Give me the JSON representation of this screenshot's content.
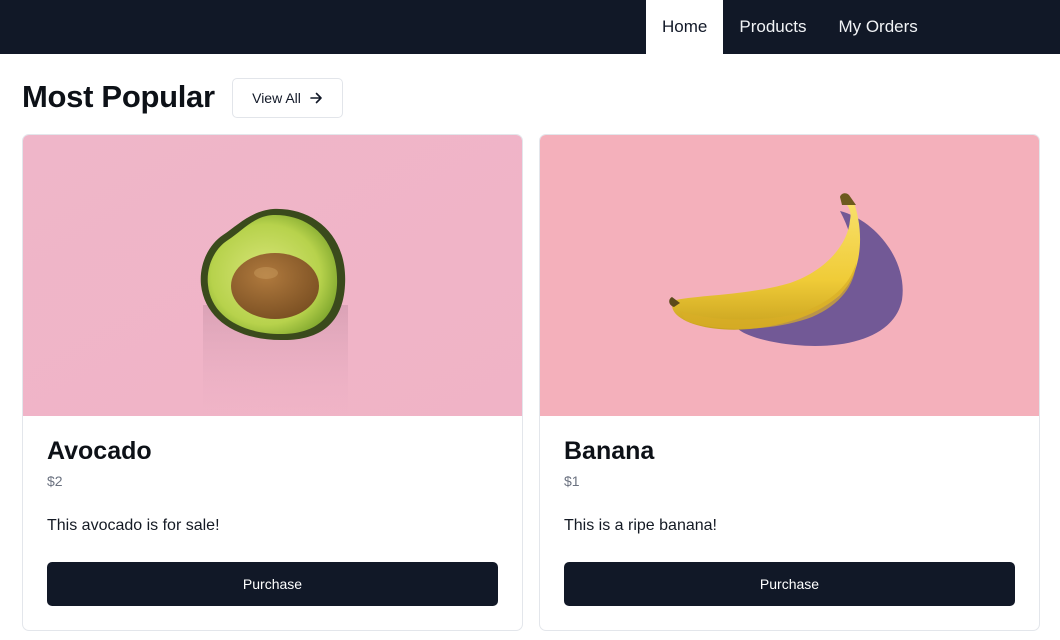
{
  "nav": {
    "tabs": [
      {
        "label": "Home",
        "active": true
      },
      {
        "label": "Products",
        "active": false
      },
      {
        "label": "My Orders",
        "active": false
      }
    ]
  },
  "header": {
    "title": "Most Popular",
    "view_all_label": "View All",
    "view_all_icon": "arrow-right-icon"
  },
  "products": [
    {
      "name": "Avocado",
      "price": "$2",
      "description": "This avocado is for sale!",
      "button_label": "Purchase",
      "image": "avocado-half-photo",
      "image_bg": "#f0b4c8"
    },
    {
      "name": "Banana",
      "price": "$1",
      "description": "This is a ripe banana!",
      "button_label": "Purchase",
      "image": "banana-photo",
      "image_bg": "#f4b0bb"
    }
  ],
  "colors": {
    "nav_bg": "#111827",
    "button_bg": "#111827",
    "price_text": "#6b7280"
  }
}
